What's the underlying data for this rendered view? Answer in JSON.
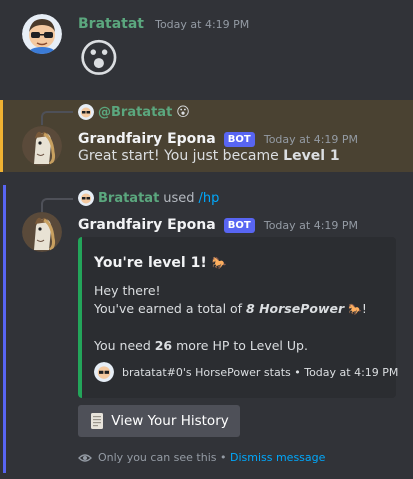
{
  "colors": {
    "bratatat_name": "#5ba77e",
    "bot_name": "#f2f3f5",
    "accent": "#5865f2",
    "embed_border": "#23a55a",
    "mention_bg": "#4a4232"
  },
  "msg1": {
    "author": "Bratatat",
    "timestamp": "Today at 4:19 PM",
    "content_emoji": "😮"
  },
  "msg2": {
    "reply_mention": "@Bratatat",
    "reply_emoji": "😮",
    "author": "Grandfairy Epona",
    "bot_tag": "BOT",
    "timestamp": "Today at 4:19 PM",
    "text_prefix": "Great start! You just became ",
    "text_bold": "Level 1"
  },
  "msg3": {
    "interaction_user": "Bratatat",
    "interaction_verb": "used",
    "command": "/hp",
    "author": "Grandfairy Epona",
    "bot_tag": "BOT",
    "timestamp": "Today at 4:19 PM",
    "embed": {
      "title": "You're level 1!",
      "title_emoji": "🐎",
      "line1": "Hey there!",
      "line2_prefix": "You've earned a total of ",
      "line2_bold": "8 HorsePower",
      "line2_emoji": "🐎",
      "line2_suffix": "!",
      "line3_prefix": "You need ",
      "line3_bold": "26",
      "line3_suffix": " more HP to Level Up.",
      "footer": "bratatat#0's HorsePower stats • Today at 4:19 PM"
    },
    "button_label": "View Your History",
    "button_icon": "scroll-icon",
    "ephemeral_note": "Only you can see this • ",
    "dismiss_link": "Dismiss message"
  }
}
